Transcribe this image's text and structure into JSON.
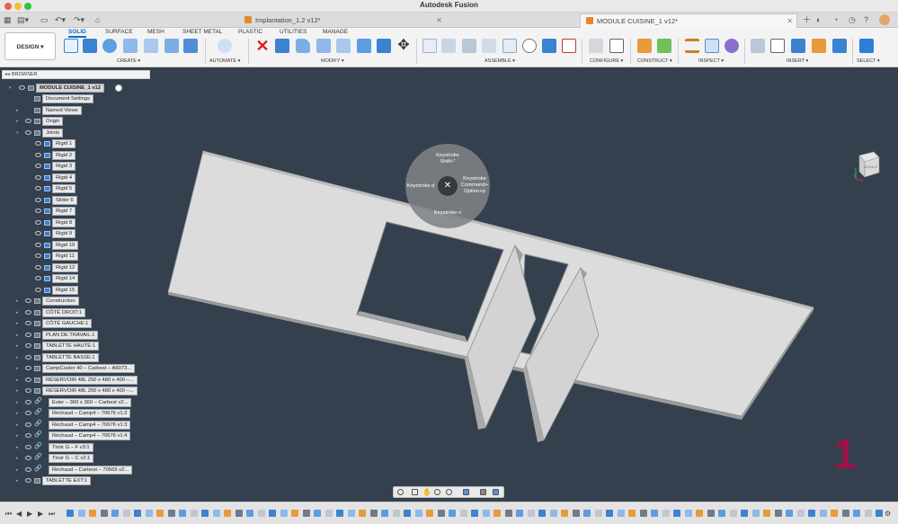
{
  "app_title": "Autodesk Fusion",
  "tabs": [
    {
      "label": "Implantation_1.2 v12*",
      "active": false
    },
    {
      "label": "MODULE CUISINE_1 v12*",
      "active": true
    }
  ],
  "toolbar": {
    "workspace_button": "DESIGN ▾",
    "workspace_tabs": [
      "SOLID",
      "SURFACE",
      "MESH",
      "SHEET METAL",
      "PLASTIC",
      "UTILITIES",
      "MANAGE"
    ],
    "groups": [
      "CREATE ▾",
      "AUTOMATE ▾",
      "MODIFY ▾",
      "ASSEMBLE ▾",
      "CONFIGURE ▾",
      "CONSTRUCT ▾",
      "INSPECT ▾",
      "INSERT ▾",
      "SELECT ▾"
    ]
  },
  "browser": {
    "title": "BROWSER",
    "root": "MODULE CUISINE_1 v12",
    "items": [
      "Document Settings",
      "Named Views",
      "Origin",
      "Joints",
      "Rigid 1",
      "Rigid 2",
      "Rigid 3",
      "Rigid 4",
      "Rigid 5",
      "Slider 6",
      "Rigid 7",
      "Rigid 8",
      "Rigid 9",
      "Rigid 10",
      "Rigid 11",
      "Rigid 12",
      "Rigid 14",
      "Rigid 15",
      "Construction",
      "CÔTÉ DROIT:1",
      "CÔTÉ GAUCHE:1",
      "PLAN DE TRAVAIL:1",
      "TABLETTE HAUTE:1",
      "TABLETTE BASSE:1",
      "CampCooler 40 – Carbest – A6073...",
      "RÉSERVOIR 48L 250 x 480 x 400 –...",
      "RÉSERVOIR 48L 250 x 480 x 400 –...",
      "Evier – 360 x 360 – Carbest v2...",
      "Réchaud – Camp4 – 70676 v1:2",
      "Réchaud – Camp4 – 70676 v1:3",
      "Réchaud – Camp4 – 70676 v1:4",
      "Tiroir G – F v3:1",
      "Tiroir G – C v2:1",
      "Réchaud – Carbest – 70569 v2...",
      "TABLETTE EXT:1"
    ]
  },
  "marking_menu": {
    "top": "Keystroke\nShift+\"",
    "right": "Keystroke\nCommand+\nOption+p",
    "left": "Keystroke d",
    "bottom": "Keystroke n"
  },
  "viewcube_label": "MIDDLE",
  "canvas_label": "1",
  "colors": {
    "canvas": "#34404d",
    "accent": "#0b6fcc",
    "label": "#a01049"
  }
}
